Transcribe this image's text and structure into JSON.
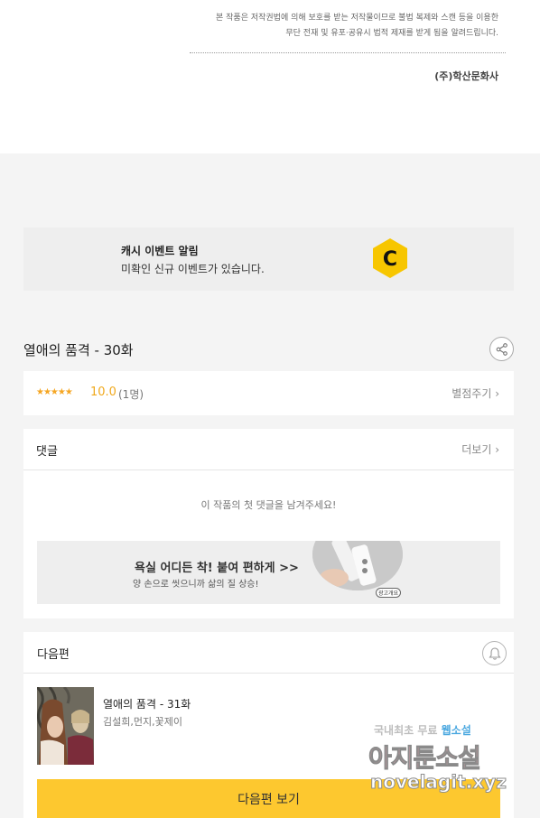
{
  "copyright": {
    "line1": "본 작품은 저작권법에 의해 보호를 받는 저작물이므로 불법 복제와 스캔 등을 이용한",
    "line2": "무단 전재 및 유포·공유시 법적 제재를 받게 됨을 알려드립니다.",
    "publisher": "(주)학산문화사"
  },
  "cash_event": {
    "title": "캐시 이벤트 알림",
    "desc": "미확인 신규 이벤트가 있습니다.",
    "logo_letter": "C",
    "logo_color": "#f7c600"
  },
  "episode": {
    "title": "열애의 품격 - 30화",
    "share_icon": "share-icon"
  },
  "rating": {
    "stars": "★★★★★",
    "score": "10.0",
    "count": "(1명)",
    "action": "별점주기 ›"
  },
  "comments": {
    "title": "댓글",
    "more": "더보기 ›",
    "empty": "이 작품의 첫 댓글을 남겨주세요!"
  },
  "ad": {
    "title": "욕실 어디든 착! 붙여 편하게 >>",
    "desc": "양 손으로 씻으니까 삶의 질 상승!",
    "tag": "광고개요"
  },
  "next_episode": {
    "section_title": "다음편",
    "bell_icon": "bell-icon",
    "title": "열애의 품격 - 31화",
    "authors": "김설희,먼지,꽃제이",
    "button": "다음편 보기",
    "button_color": "#fdc82f"
  },
  "watermark": {
    "line1_a": "국내최초 무료 ",
    "line1_b": "웹소설",
    "line2": "아지툰소설",
    "line3": "novelagit.xyz"
  }
}
